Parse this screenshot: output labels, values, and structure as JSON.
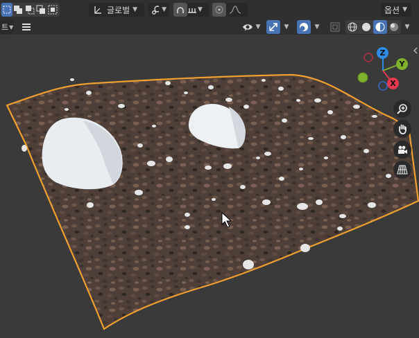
{
  "header": {
    "orientation_label": "글로벌",
    "options_label": "옵션",
    "left_cut_label": "트"
  },
  "icons": {
    "select_modes": [
      "select-new-icon",
      "select-extend-icon",
      "select-subtract-icon",
      "select-invert-icon",
      "select-intersect-icon"
    ],
    "pivot": "pivot-icon",
    "snap": "snap-icon",
    "proportional": "proportional-edit-icon",
    "falloff": "falloff-icon",
    "visibility": "eye-icon",
    "gizmo": "gizmo-icon",
    "overlay": "overlay-icon",
    "xray": "xray-icon",
    "shading": [
      "wireframe-shading-icon",
      "solid-shading-icon",
      "material-shading-icon",
      "rendered-shading-icon"
    ],
    "nav": [
      "zoom-icon",
      "pan-hand-icon",
      "camera-icon",
      "grid-perspective-icon"
    ]
  },
  "gizmo_axes": {
    "x": "X",
    "y": "Y",
    "z": "Z",
    "colors": {
      "x": "#e8394e",
      "y": "#7fb02e",
      "z": "#2e8ce6"
    }
  },
  "colors": {
    "accent": "#4772b3",
    "selection_outline": "#f0a030",
    "header_bg": "#303030",
    "viewport_bg": "#3a3a3a"
  }
}
